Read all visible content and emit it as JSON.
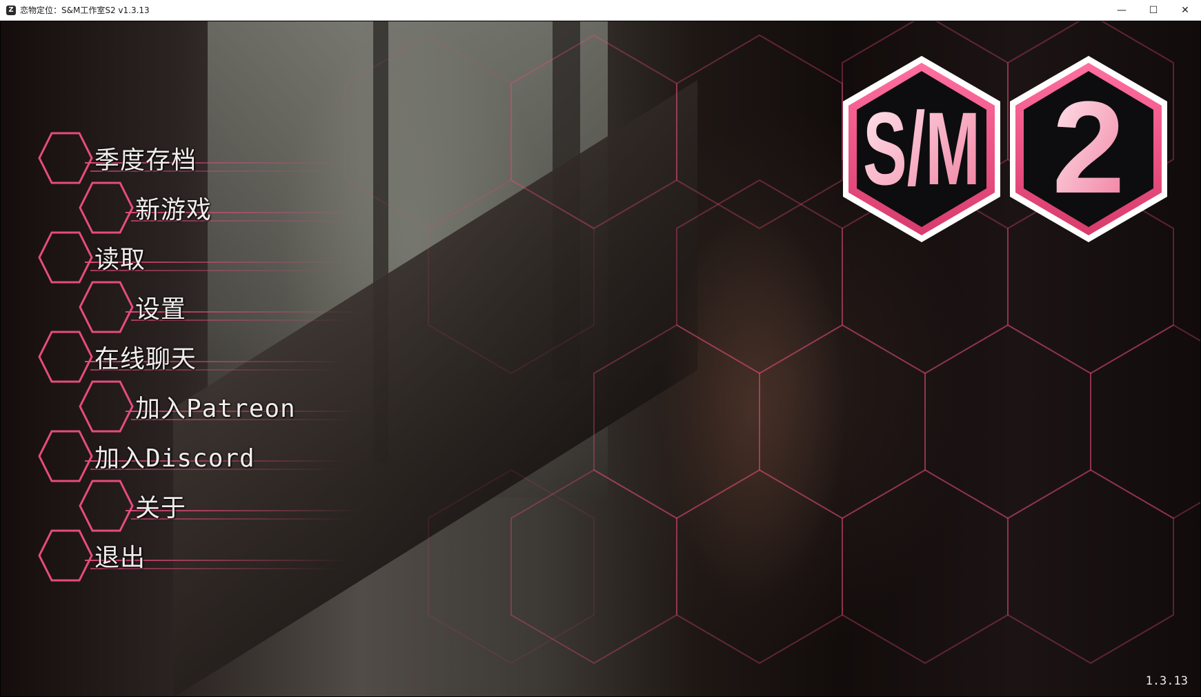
{
  "window": {
    "title": "恋物定位：S&M工作室S2 v1.3.13",
    "app_icon_glyph": "Z",
    "controls": {
      "minimize": "—",
      "maximize": "☐",
      "close": "✕"
    }
  },
  "theme": {
    "accent": "#e74c7c",
    "text": "#f1eded"
  },
  "logo": {
    "left_mark": "S/M",
    "right_mark": "2"
  },
  "menu": {
    "items": [
      {
        "label": "季度存档"
      },
      {
        "label": "新游戏"
      },
      {
        "label": "读取"
      },
      {
        "label": "设置"
      },
      {
        "label": "在线聊天"
      },
      {
        "label": "加入Patreon"
      },
      {
        "label": "加入Discord"
      },
      {
        "label": "关于"
      },
      {
        "label": "退出"
      }
    ]
  },
  "version": "1.3.13"
}
